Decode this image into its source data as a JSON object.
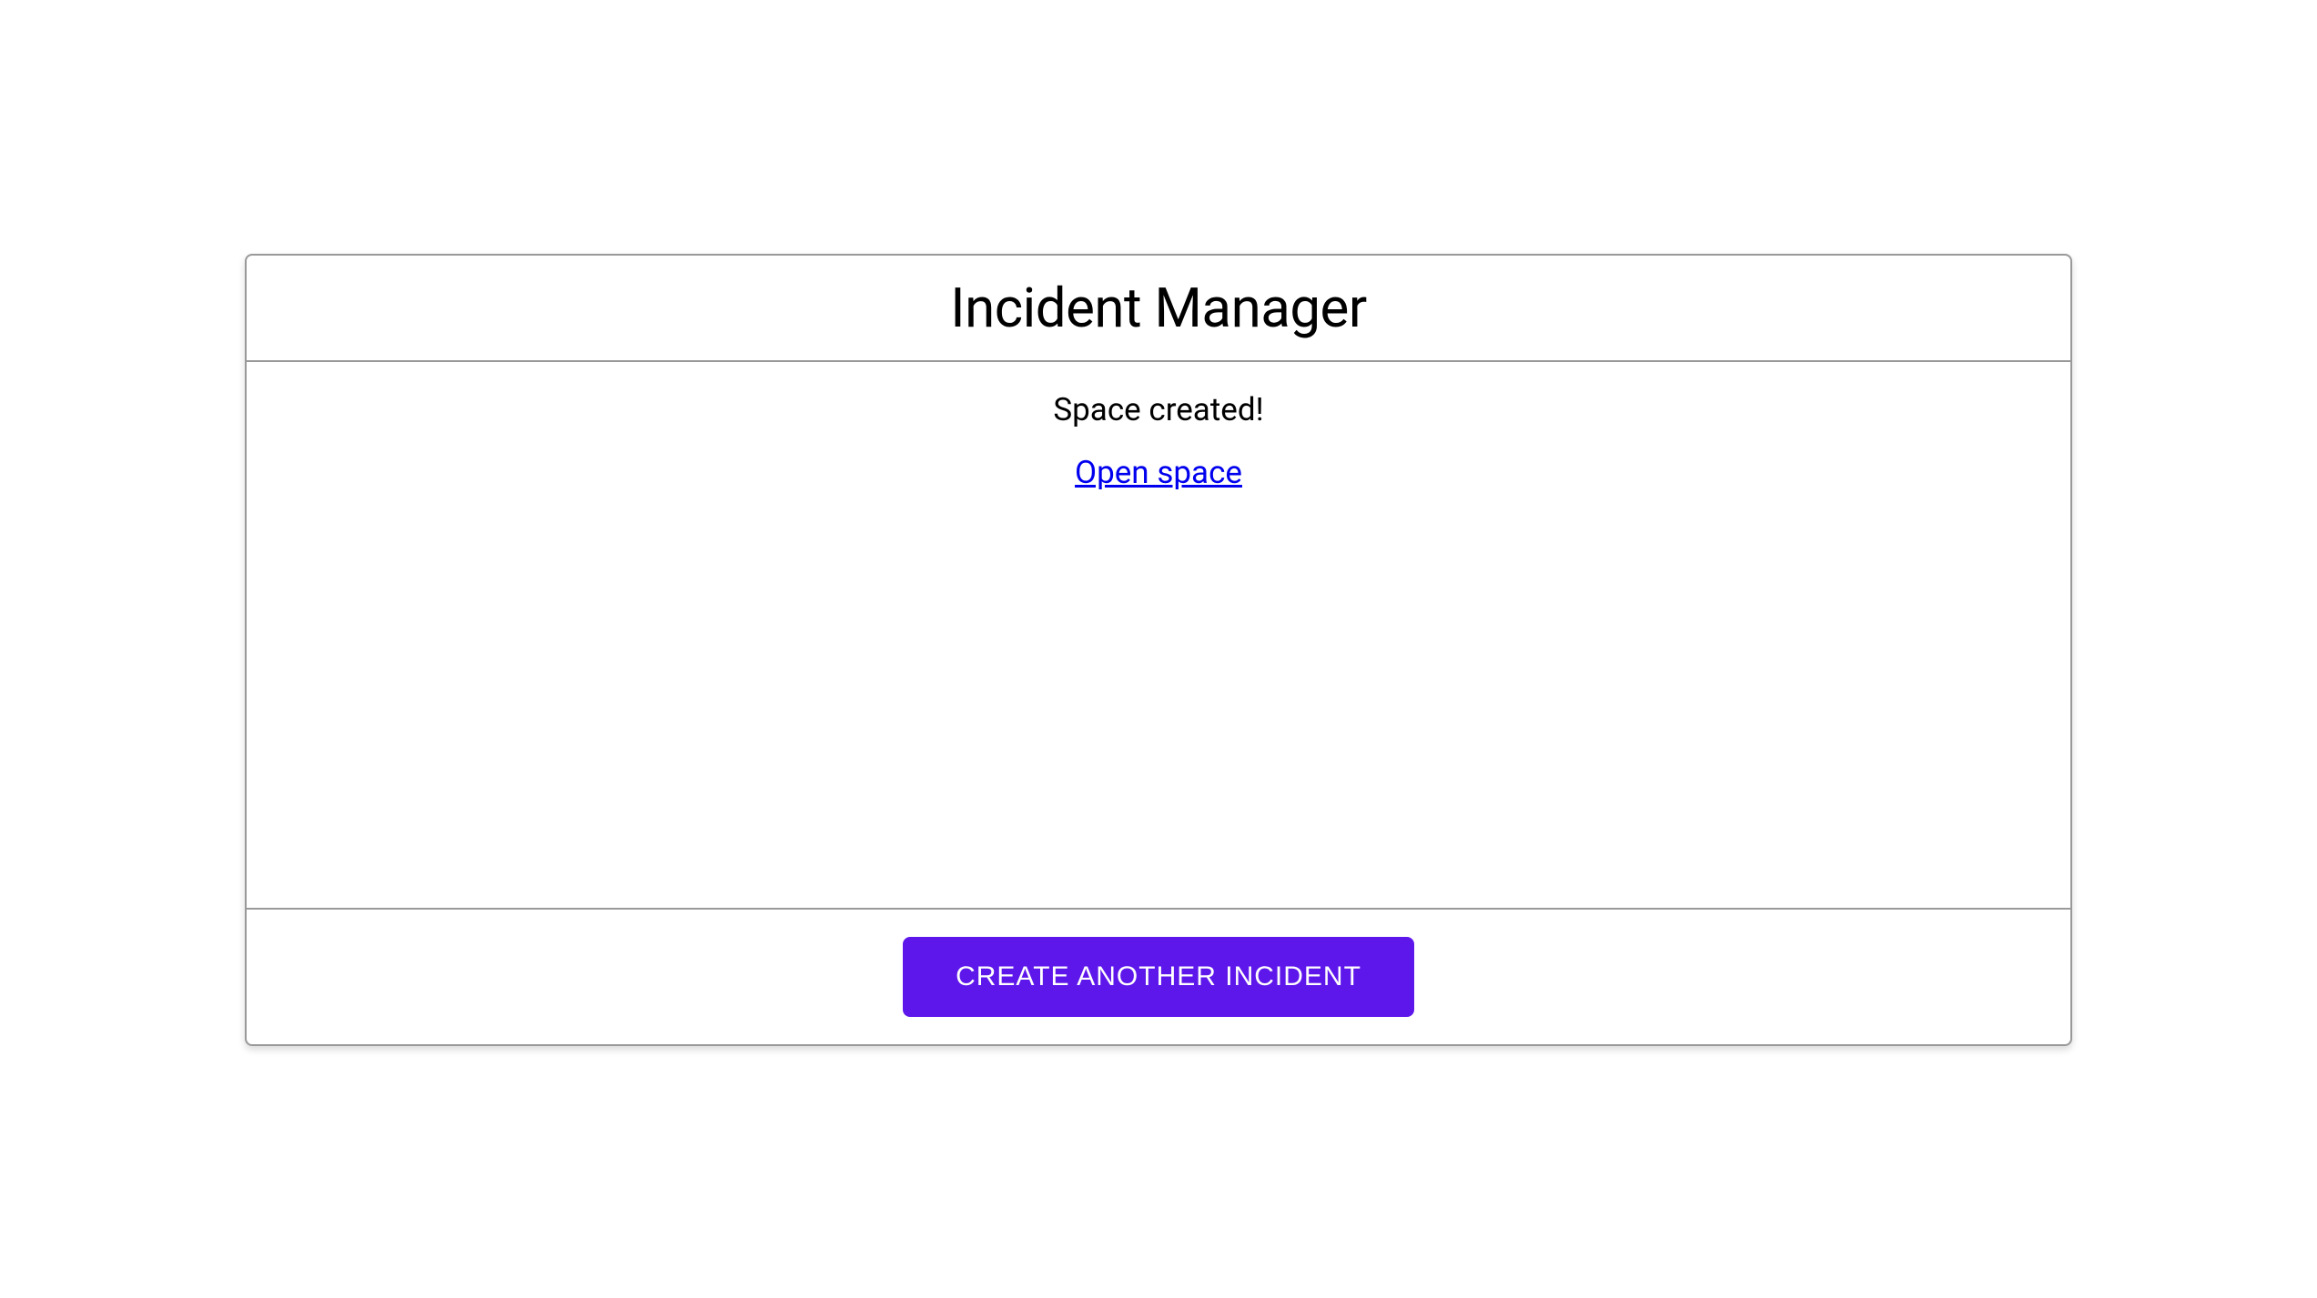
{
  "header": {
    "title": "Incident Manager"
  },
  "body": {
    "status_message": "Space created!",
    "open_link_label": "Open space"
  },
  "footer": {
    "create_button_label": "CREATE ANOTHER INCIDENT"
  },
  "colors": {
    "primary": "#5E17EB",
    "border": "#999999",
    "link": "#0000EE"
  }
}
